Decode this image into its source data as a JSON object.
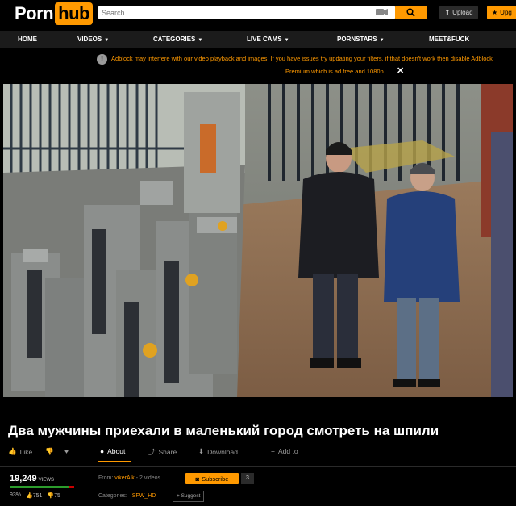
{
  "header": {
    "logo": {
      "porn": "Porn",
      "hub": "hub"
    },
    "search_placeholder": "Search...",
    "upload_label": "Upload",
    "upgrade_label": "Upg"
  },
  "nav": {
    "items": [
      {
        "label": "HOME",
        "caret": false
      },
      {
        "label": "VIDEOS",
        "caret": true
      },
      {
        "label": "CATEGORIES",
        "caret": true
      },
      {
        "label": "LIVE CAMS",
        "caret": true
      },
      {
        "label": "PORNSTARS",
        "caret": true
      },
      {
        "label": "MEET&FUCK",
        "caret": false
      }
    ]
  },
  "notice": {
    "line1": "Adblock may interfere with our video playback and images. If you have issues try updating your filters, if that doesn't work then disable Adblock",
    "line2": "Premium which is ad free and 1080p."
  },
  "video": {
    "title": "Два мужчины приехали в маленький город смотреть на шпили"
  },
  "actions": {
    "like": "Like",
    "about": "About",
    "share": "Share",
    "download": "Download",
    "add_to": "Add to"
  },
  "stats": {
    "views": "19,249",
    "views_label": "VIEWS",
    "rating_percent": "93%",
    "rating_fraction": 0.93,
    "likes": "751",
    "dislikes": "75",
    "from_label": "From:",
    "uploader": "vikerAlk",
    "video_count": "- 2 videos",
    "subscribe_label": "Subscribe",
    "subscriber_count": "3",
    "categories_label": "Categories:",
    "category": "SFW_HD",
    "suggest_label": "+ Suggest"
  },
  "colors": {
    "accent": "#ff9900",
    "background": "#000000",
    "nav_bg": "#1b1b1b"
  }
}
